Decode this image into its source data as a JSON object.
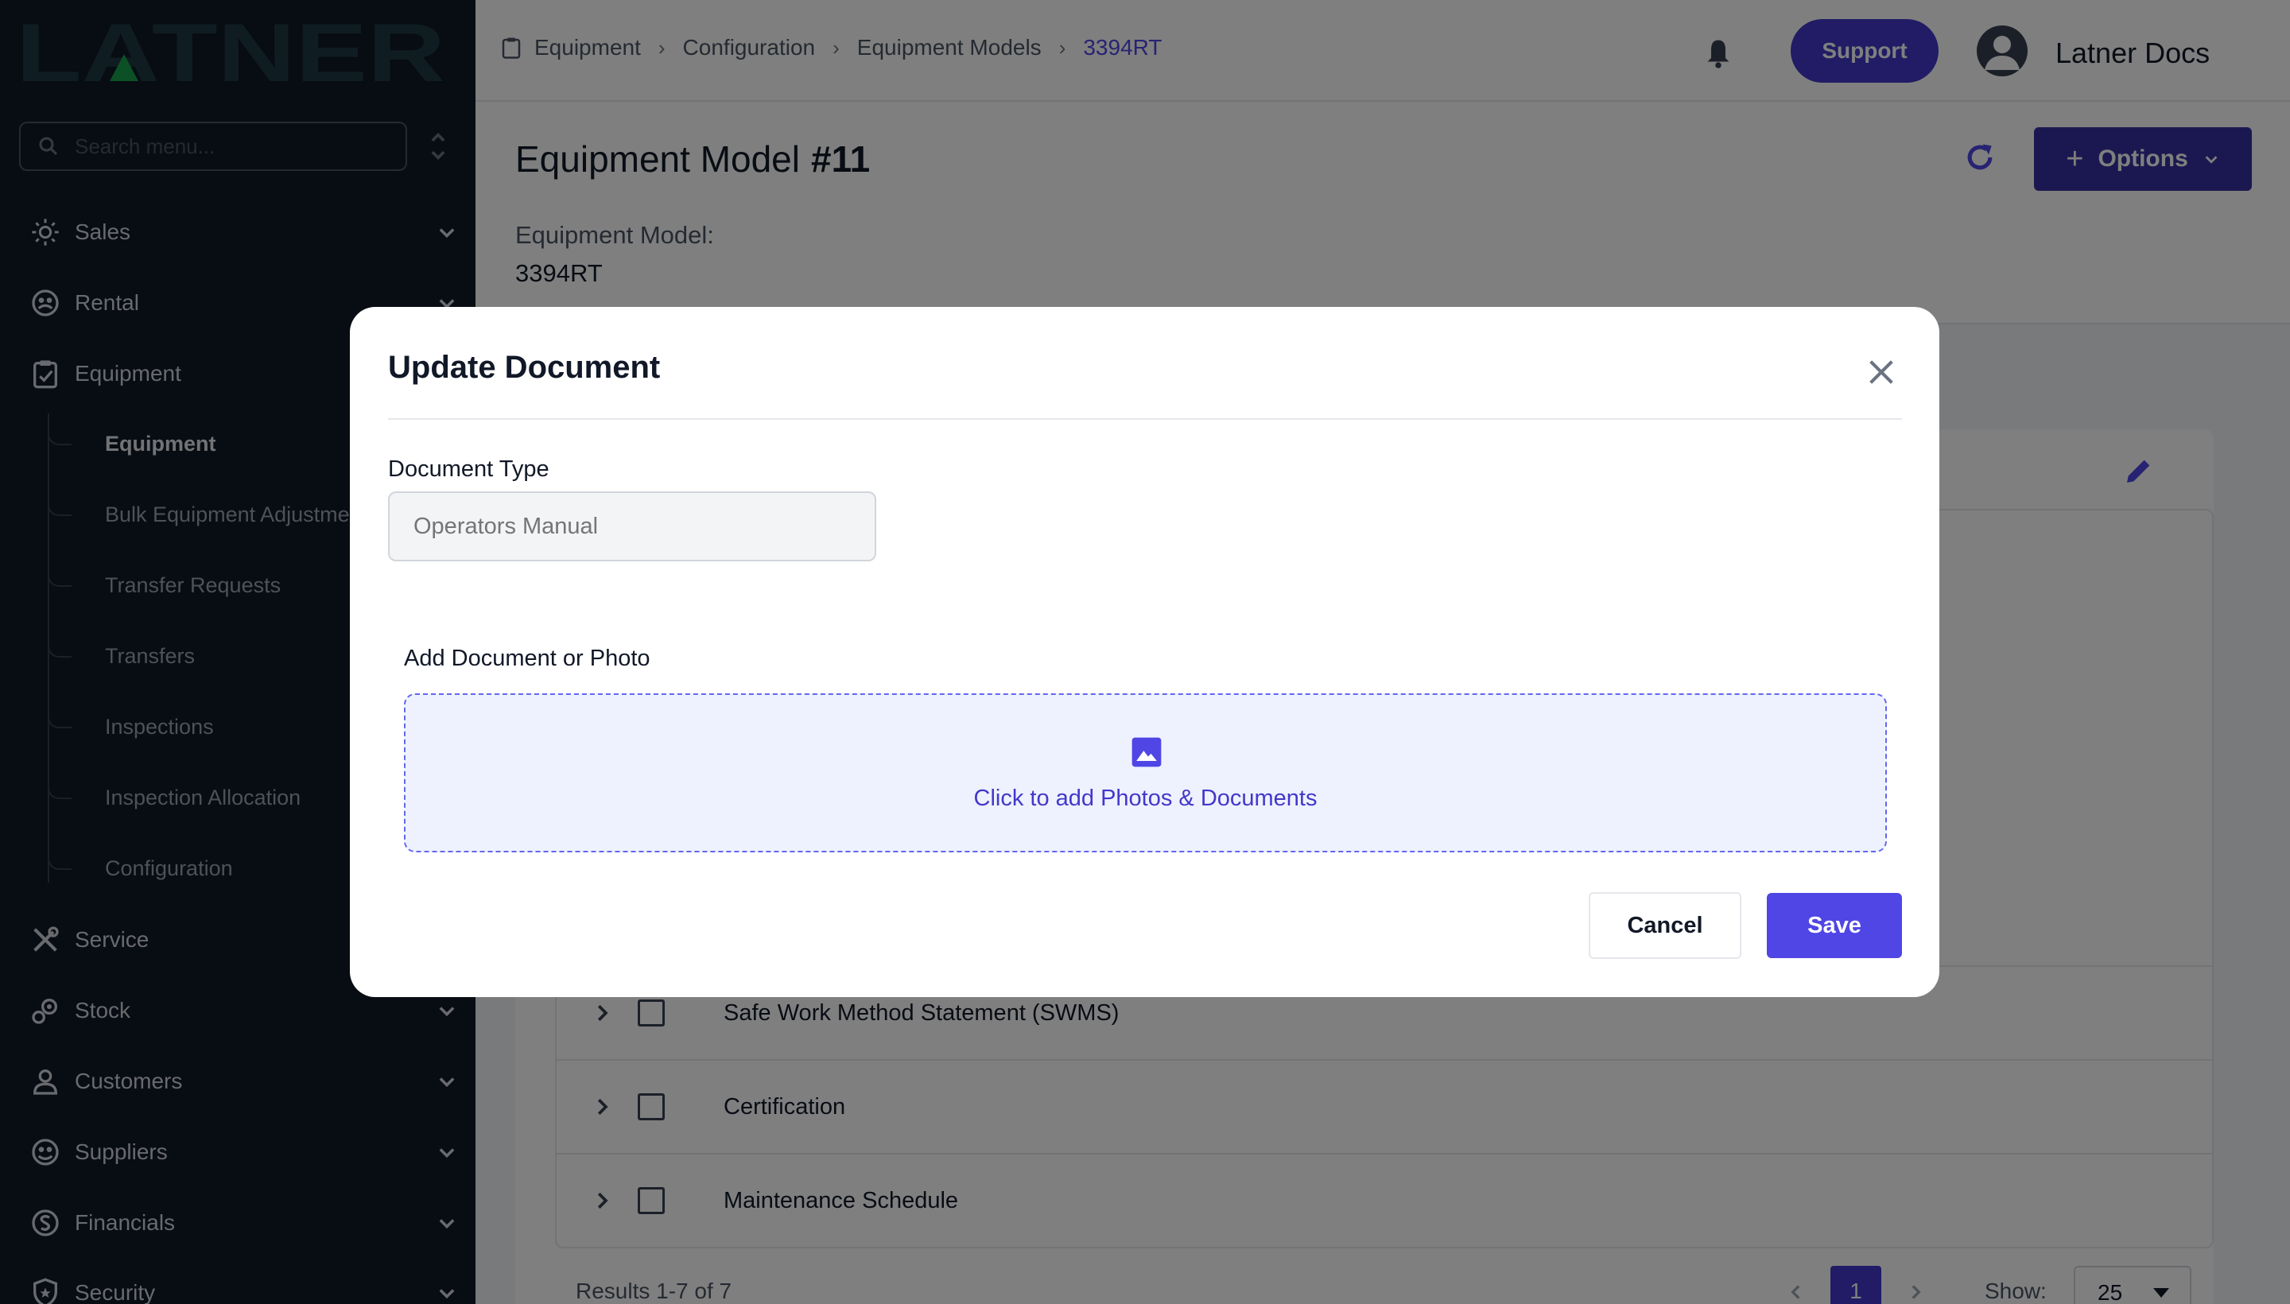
{
  "brand": {
    "logo_text": "LATNER"
  },
  "sidebar": {
    "search_placeholder": "Search menu...",
    "items": [
      {
        "label": "Sales",
        "icon": "sales-icon",
        "expandable": true
      },
      {
        "label": "Rental",
        "icon": "rental-icon",
        "expandable": true
      },
      {
        "label": "Equipment",
        "icon": "equipment-icon",
        "expandable": false
      },
      {
        "label": "Service",
        "icon": "service-icon",
        "expandable": false
      },
      {
        "label": "Stock",
        "icon": "stock-icon",
        "expandable": true
      },
      {
        "label": "Customers",
        "icon": "customers-icon",
        "expandable": true
      },
      {
        "label": "Suppliers",
        "icon": "suppliers-icon",
        "expandable": true
      },
      {
        "label": "Financials",
        "icon": "financials-icon",
        "expandable": true
      },
      {
        "label": "Security",
        "icon": "security-icon",
        "expandable": true
      }
    ],
    "equipment_sub": [
      {
        "label": "Equipment",
        "active": true
      },
      {
        "label": "Bulk Equipment Adjustments",
        "active": false
      },
      {
        "label": "Transfer Requests",
        "active": false
      },
      {
        "label": "Transfers",
        "active": false
      },
      {
        "label": "Inspections",
        "active": false
      },
      {
        "label": "Inspection Allocation",
        "active": false
      },
      {
        "label": "Configuration",
        "active": false
      }
    ]
  },
  "topbar": {
    "breadcrumbs": [
      "Equipment",
      "Configuration",
      "Equipment Models",
      "3394RT"
    ],
    "support_label": "Support",
    "user_name": "Latner Docs"
  },
  "page": {
    "title": "Equipment Model",
    "id": "#11",
    "model_label": "Equipment Model:",
    "model_value": "3394RT",
    "options_label": "Options"
  },
  "documents": {
    "rows": [
      {
        "name": "Safe Work Method Statement (SWMS)"
      },
      {
        "name": "Certification"
      },
      {
        "name": "Maintenance Schedule"
      }
    ],
    "results_text": "Results 1-7 of 7",
    "current_page": "1",
    "show_label": "Show:",
    "show_value": "25"
  },
  "modal": {
    "title": "Update Document",
    "doc_type_label": "Document Type",
    "doc_type_placeholder": "Operators Manual",
    "upload_label": "Add Document or Photo",
    "upload_text": "Click to add Photos & Documents",
    "cancel_label": "Cancel",
    "save_label": "Save"
  },
  "colors": {
    "accent": "#4f46e5",
    "sidebar_bg": "#111827",
    "logo_color": "#1f3a44",
    "logo_triangle": "#16a34a"
  }
}
